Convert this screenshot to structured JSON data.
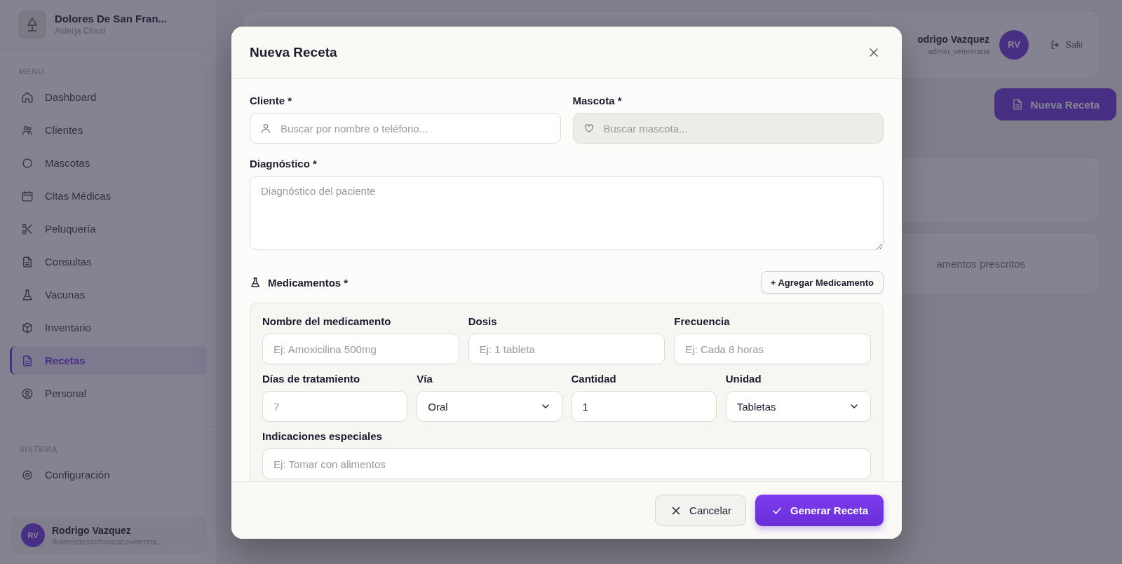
{
  "sidebar": {
    "brand_name": "Dolores De San Fran...",
    "brand_subtitle": "Asterja Cloud",
    "sections": [
      {
        "heading": "MENU",
        "items": [
          {
            "label": "Dashboard",
            "selected": false
          },
          {
            "label": "Clientes",
            "selected": false
          },
          {
            "label": "Mascotas",
            "selected": false
          },
          {
            "label": "Citas Médicas",
            "selected": false
          },
          {
            "label": "Peluquería",
            "selected": false
          },
          {
            "label": "Consultas",
            "selected": false
          },
          {
            "label": "Vacunas",
            "selected": false
          },
          {
            "label": "Inventario",
            "selected": false
          },
          {
            "label": "Recetas",
            "selected": true
          },
          {
            "label": "Personal",
            "selected": false
          }
        ]
      },
      {
        "heading": "SISTEMA",
        "items": [
          {
            "label": "Configuración",
            "selected": false
          }
        ]
      }
    ],
    "user": {
      "initials": "RV",
      "name": "Rodrigo Vazquez",
      "email": "doloresdesanfranciscoveterina..."
    }
  },
  "header": {
    "user_name": "odrigo Vazquez",
    "user_role": "admin_veterinaria",
    "initials": "RV",
    "logout": "Salir"
  },
  "page": {
    "new_button": "Nueva Receta",
    "empty_text": "amentos prescritos"
  },
  "modal": {
    "title": "Nueva Receta",
    "cliente": {
      "label": "Cliente *",
      "placeholder": "Buscar por nombre o teléfono...",
      "disabled": false
    },
    "mascota": {
      "label": "Mascota *",
      "placeholder": "Buscar mascota...",
      "disabled": true
    },
    "diagnostico": {
      "label": "Diagnóstico *",
      "placeholder": "Diagnóstico del paciente"
    },
    "medicamentos": {
      "title": "Medicamentos *",
      "add_button": "+ Agregar Medicamento",
      "fields": [
        {
          "kind": "input",
          "label": "Nombre del medicamento",
          "placeholder": "Ej: Amoxicilina 500mg"
        },
        {
          "kind": "input",
          "label": "Dosis",
          "placeholder": "Ej: 1 tableta"
        },
        {
          "kind": "input",
          "label": "Frecuencia",
          "placeholder": "Ej: Cada 8 horas"
        },
        {
          "kind": "input",
          "label": "Días de tratamiento",
          "placeholder": "7"
        },
        {
          "kind": "select",
          "label": "Vía",
          "value": "Oral"
        },
        {
          "kind": "input",
          "label": "Cantidad",
          "value": "1"
        },
        {
          "kind": "select",
          "label": "Unidad",
          "value": "Tabletas"
        },
        {
          "kind": "input",
          "label": "Indicaciones especiales",
          "placeholder": "Ej: Tomar con alimentos"
        }
      ]
    },
    "cancel_button": "Cancelar",
    "submit_button": "Generar Receta"
  }
}
